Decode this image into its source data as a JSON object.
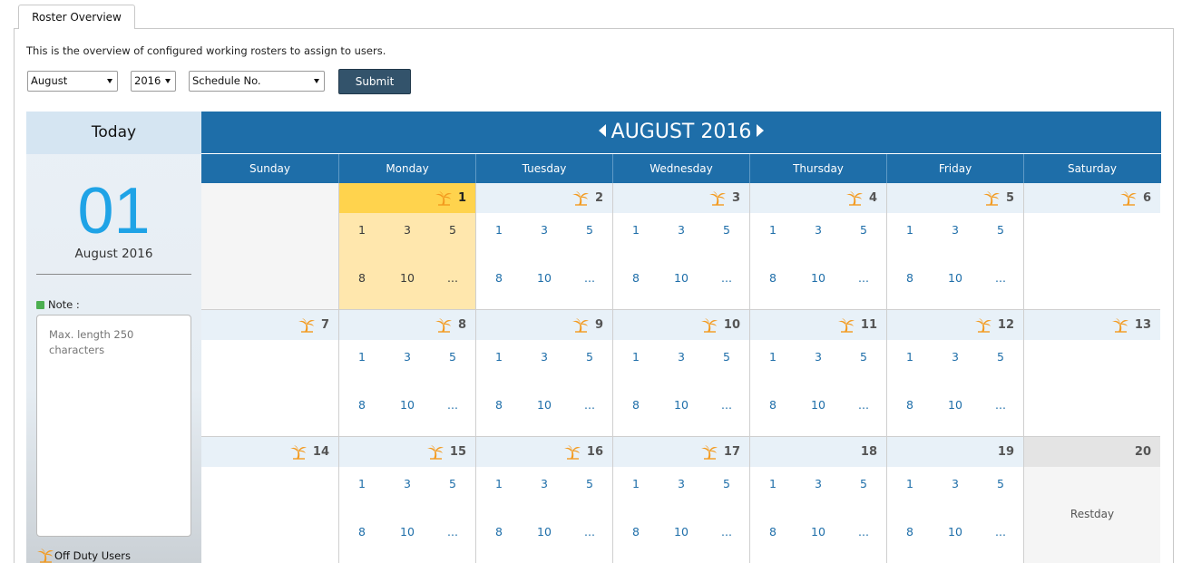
{
  "tab": {
    "label": "Roster Overview"
  },
  "intro": "This is the overview of configured working rosters to assign to users.",
  "filters": {
    "month": "August",
    "year": "2016",
    "schedule": "Schedule No.",
    "submit": "Submit"
  },
  "sidebar": {
    "title": "Today",
    "day": "01",
    "month_year": "August 2016",
    "note_label": "Note :",
    "note_placeholder": "Max. length 250 characters",
    "off_duty": "Off Duty Users"
  },
  "calendar": {
    "title": "AUGUST 2016",
    "weekdays": [
      "Sunday",
      "Monday",
      "Tuesday",
      "Wednesday",
      "Thursday",
      "Friday",
      "Saturday"
    ],
    "weeks": [
      [
        {
          "day": "",
          "type": "empty"
        },
        {
          "day": "1",
          "holiday": true,
          "type": "today",
          "slots": [
            "1",
            "3",
            "5",
            "8",
            "10",
            "..."
          ]
        },
        {
          "day": "2",
          "holiday": true,
          "slots": [
            "1",
            "3",
            "5",
            "8",
            "10",
            "..."
          ]
        },
        {
          "day": "3",
          "holiday": true,
          "slots": [
            "1",
            "3",
            "5",
            "8",
            "10",
            "..."
          ]
        },
        {
          "day": "4",
          "holiday": true,
          "slots": [
            "1",
            "3",
            "5",
            "8",
            "10",
            "..."
          ]
        },
        {
          "day": "5",
          "holiday": true,
          "slots": [
            "1",
            "3",
            "5",
            "8",
            "10",
            "..."
          ]
        },
        {
          "day": "6",
          "holiday": true,
          "slots": []
        }
      ],
      [
        {
          "day": "7",
          "holiday": true,
          "slots": []
        },
        {
          "day": "8",
          "holiday": true,
          "slots": [
            "1",
            "3",
            "5",
            "8",
            "10",
            "..."
          ]
        },
        {
          "day": "9",
          "holiday": true,
          "slots": [
            "1",
            "3",
            "5",
            "8",
            "10",
            "..."
          ]
        },
        {
          "day": "10",
          "holiday": true,
          "slots": [
            "1",
            "3",
            "5",
            "8",
            "10",
            "..."
          ]
        },
        {
          "day": "11",
          "holiday": true,
          "slots": [
            "1",
            "3",
            "5",
            "8",
            "10",
            "..."
          ]
        },
        {
          "day": "12",
          "holiday": true,
          "slots": [
            "1",
            "3",
            "5",
            "8",
            "10",
            "..."
          ]
        },
        {
          "day": "13",
          "holiday": true,
          "slots": []
        }
      ],
      [
        {
          "day": "14",
          "holiday": true,
          "slots": []
        },
        {
          "day": "15",
          "holiday": true,
          "slots": [
            "1",
            "3",
            "5",
            "8",
            "10",
            "..."
          ]
        },
        {
          "day": "16",
          "holiday": true,
          "slots": [
            "1",
            "3",
            "5",
            "8",
            "10",
            "..."
          ]
        },
        {
          "day": "17",
          "holiday": true,
          "slots": [
            "1",
            "3",
            "5",
            "8",
            "10",
            "..."
          ]
        },
        {
          "day": "18",
          "holiday": false,
          "slots": [
            "1",
            "3",
            "5",
            "8",
            "10",
            "..."
          ]
        },
        {
          "day": "19",
          "holiday": false,
          "slots": [
            "1",
            "3",
            "5",
            "8",
            "10",
            "..."
          ]
        },
        {
          "day": "20",
          "holiday": false,
          "type": "rest",
          "label": "Restday",
          "slots": []
        }
      ]
    ]
  },
  "colors": {
    "header": "#1e6ea9",
    "today_top": "#ffd34d",
    "today_body": "#ffe7ad",
    "link": "#1e6ea9",
    "palm": "#f39a1f"
  },
  "icons": {
    "holiday": "palm-tree-icon",
    "note": "note-square-icon",
    "nav_prev": "chevron-left-icon",
    "nav_next": "chevron-right-icon"
  }
}
